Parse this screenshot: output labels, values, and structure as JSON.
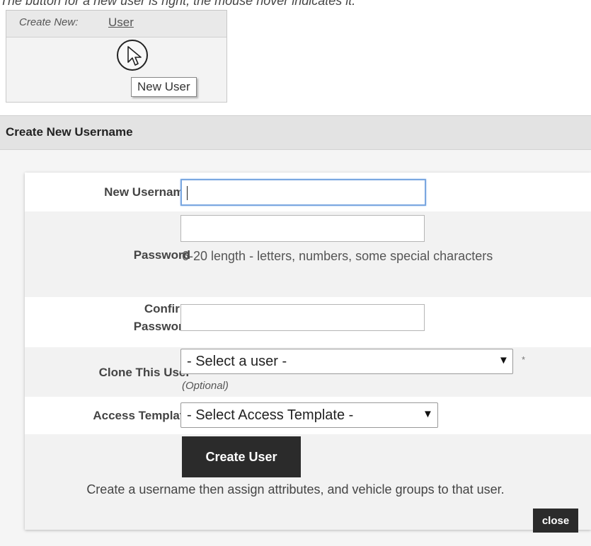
{
  "top_cut_text": "The button for a new user is right, the mouse hover indicates it.",
  "snippet": {
    "label": "Create New:",
    "link": "User",
    "tooltip": "New User"
  },
  "dialog": {
    "title": "Create New Username",
    "fields": {
      "username": {
        "label": "New Username",
        "value": ""
      },
      "password": {
        "label": "Password",
        "value": "",
        "hint": "6-20 length - letters, numbers, some special characters"
      },
      "confirm": {
        "label_line1": "Confirm",
        "label_line2": "Password",
        "value": ""
      },
      "clone": {
        "label": "Clone This User",
        "selected": "- Select a user -",
        "note": "(Optional)",
        "star": "*"
      },
      "template": {
        "label": "Access Template",
        "selected": "- Select Access Template -"
      }
    },
    "submit_label": "Create User",
    "description": "Create a username then assign attributes, and vehicle groups to that user.",
    "close_label": "close"
  },
  "icons": {
    "cursor": "mouse-pointer-icon",
    "dropdown": "triangle-down-icon"
  }
}
